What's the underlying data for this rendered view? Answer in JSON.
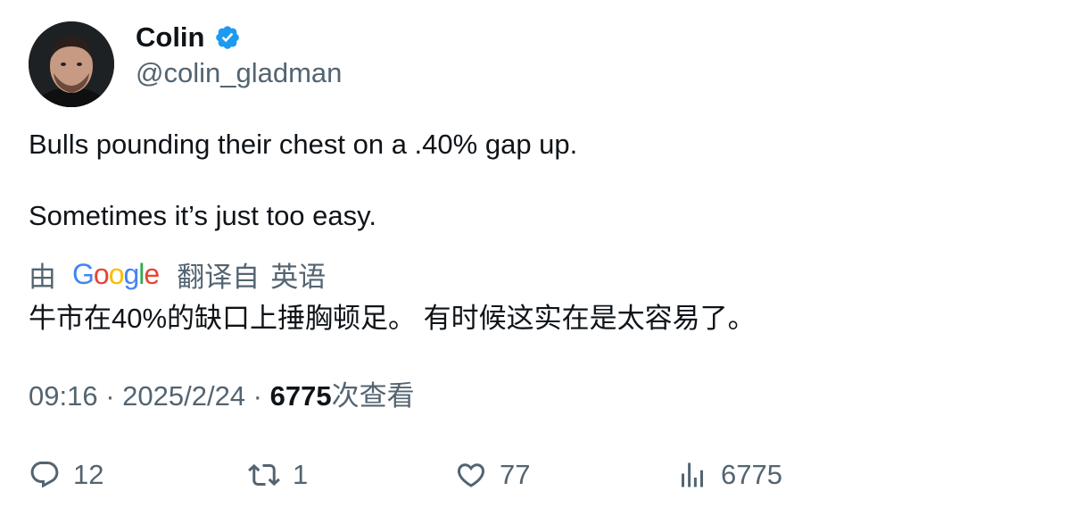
{
  "author": {
    "display_name": "Colin",
    "handle": "@colin_gladman",
    "verified": true,
    "verified_color": "#1D9BF0"
  },
  "tweet": {
    "line1": "Bulls pounding their chest on a .40% gap up.",
    "line2": "Sometimes it’s just too easy."
  },
  "translation": {
    "by": "由",
    "provider": "Google",
    "from_language": "翻译自",
    "language": "英语",
    "text": "牛市在40%的缺口上捶胸顿足。 有时候这实在是太容易了。"
  },
  "meta": {
    "time": "09:16",
    "separator": " · ",
    "date": "2025/2/24",
    "views_count": "6775",
    "views_label": "次查看"
  },
  "actions": {
    "replies": "12",
    "retweets": "1",
    "likes": "77",
    "views": "6775"
  },
  "colors": {
    "text_primary": "#0f1419",
    "text_secondary": "#536471"
  }
}
